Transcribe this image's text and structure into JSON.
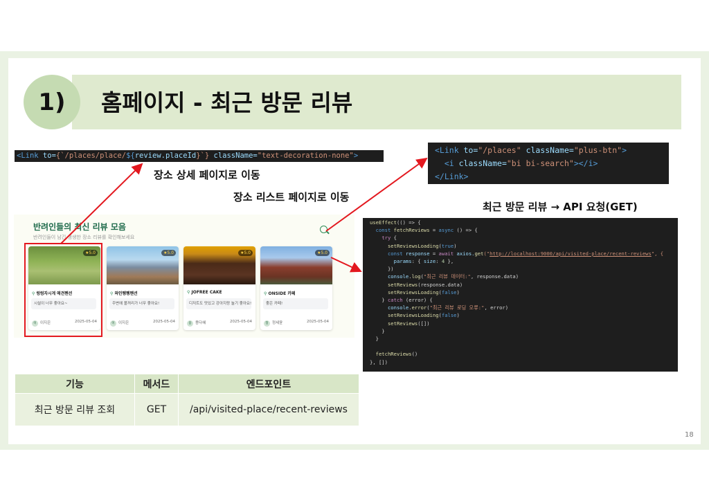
{
  "slide": {
    "number": "1)",
    "title": "홈페이지 - 최근 방문 리뷰",
    "page_number": "18"
  },
  "labels": {
    "place_detail": "장소 상세 페이지로 이동",
    "place_list": "장소 리스트 페이지로 이동",
    "api_request": "최근 방문 리뷰 → API 요청(GET)"
  },
  "code_link_detail": {
    "tag_open": "<Link",
    "attr_to": " to=",
    "value_a": "{`/places/place/",
    "value_b": "${",
    "value_c": "review.placeId",
    "value_d": "}`}",
    "attr_class": " className=",
    "value_class": "\"text-decoration-none\"",
    "tag_close": ">"
  },
  "code_link_list": {
    "line1_tag": "<Link",
    "line1_attr_to": " to=",
    "line1_to_val": "\"/places\"",
    "line1_attr_class": " className=",
    "line1_class_val": "\"plus-btn\"",
    "line1_close": ">",
    "line2_tag": "  <i",
    "line2_attr": " className=",
    "line2_val": "\"bi bi-search\"",
    "line2_close": "></i>",
    "line3": "</Link>"
  },
  "screenshot": {
    "title": "반려인들의 최신 리뷰 모음",
    "subtitle": "반려인들이 남긴 생생한 장소 리뷰를 확인해보세요",
    "cards": [
      {
        "name": "렁렁자시게 애견펜션",
        "rating": "★5.0",
        "review": "시설이 너무 좋아요~",
        "user": "이지은",
        "avatar": "이",
        "date": "2025-05-04"
      },
      {
        "name": "와인펭펭펜션",
        "rating": "★5.0",
        "review": "주변에 볼꺼리가 너무 좋아요!",
        "user": "이지은",
        "avatar": "이",
        "date": "2025-05-04"
      },
      {
        "name": "JOFREE CAKE",
        "rating": "★5.0",
        "review": "디저트도 맛있고 강아지랑 놀기 좋아요!",
        "user": "용다혜",
        "avatar": "용",
        "date": "2025-05-04"
      },
      {
        "name": "ONSIDE 카페",
        "rating": "★5.0",
        "review": "좋은 카페!",
        "user": "정세윤",
        "avatar": "정",
        "date": "2025-05-04"
      }
    ]
  },
  "code_effect": {
    "l1a": "useEffect",
    "l1b": "(() => {",
    "l2a": "  ",
    "l2b": "const",
    "l2c": " fetchReviews",
    "l2d": " = ",
    "l2e": "async",
    "l2f": " () => {",
    "l3a": "    ",
    "l3b": "try",
    "l3c": " {",
    "l4a": "      ",
    "l4b": "setReviewsLoading",
    "l4c": "(",
    "l4d": "true",
    "l4e": ")",
    "l5a": "      ",
    "l5b": "const",
    "l5c": " response",
    "l5d": " = ",
    "l5e": "await",
    "l5f": " axios.",
    "l5g": "get",
    "l5h": "(\"",
    "l5i": "http://localhost:9000/api/visited-place/recent-reviews",
    "l5j": "\", {",
    "l6a": "        ",
    "l6b": "params",
    "l6c": ": { ",
    "l6d": "size",
    "l6e": ": ",
    "l6f": "4",
    "l6g": " },",
    "l7": "      })",
    "l8a": "      ",
    "l8b": "console",
    "l8c": ".",
    "l8d": "log",
    "l8e": "(",
    "l8f": "\"최근 리뷰 데이터:\"",
    "l8g": ", response.data)",
    "l9a": "      ",
    "l9b": "setReviews",
    "l9c": "(response.data)",
    "l10a": "      ",
    "l10b": "setReviewsLoading",
    "l10c": "(",
    "l10d": "false",
    "l10e": ")",
    "l11a": "    } ",
    "l11b": "catch",
    "l11c": " (error) {",
    "l12a": "      ",
    "l12b": "console",
    "l12c": ".",
    "l12d": "error",
    "l12e": "(",
    "l12f": "\"최근 리뷰 로딩 오류:\"",
    "l12g": ", error)",
    "l13a": "      ",
    "l13b": "setReviewsLoading",
    "l13c": "(",
    "l13d": "false",
    "l13e": ")",
    "l14a": "      ",
    "l14b": "setReviews",
    "l14c": "([])",
    "l15": "    }",
    "l16": "  }",
    "l17": "",
    "l18a": "  ",
    "l18b": "fetchReviews",
    "l18c": "()",
    "l19": "}, [])"
  },
  "api_table": {
    "headers": [
      "기능",
      "메서드",
      "엔드포인트"
    ],
    "row": [
      "최근 방문 리뷰 조회",
      "GET",
      "/api/visited-place/recent-reviews"
    ]
  },
  "colors": {
    "frame": "#eaf2e3",
    "title_band": "#dfeacf",
    "circle": "#c5dbb2",
    "arrow_red": "#e3181f",
    "code_bg": "#1e1e1e",
    "table_header": "#d8e6c7",
    "table_row": "#eaf1df"
  }
}
